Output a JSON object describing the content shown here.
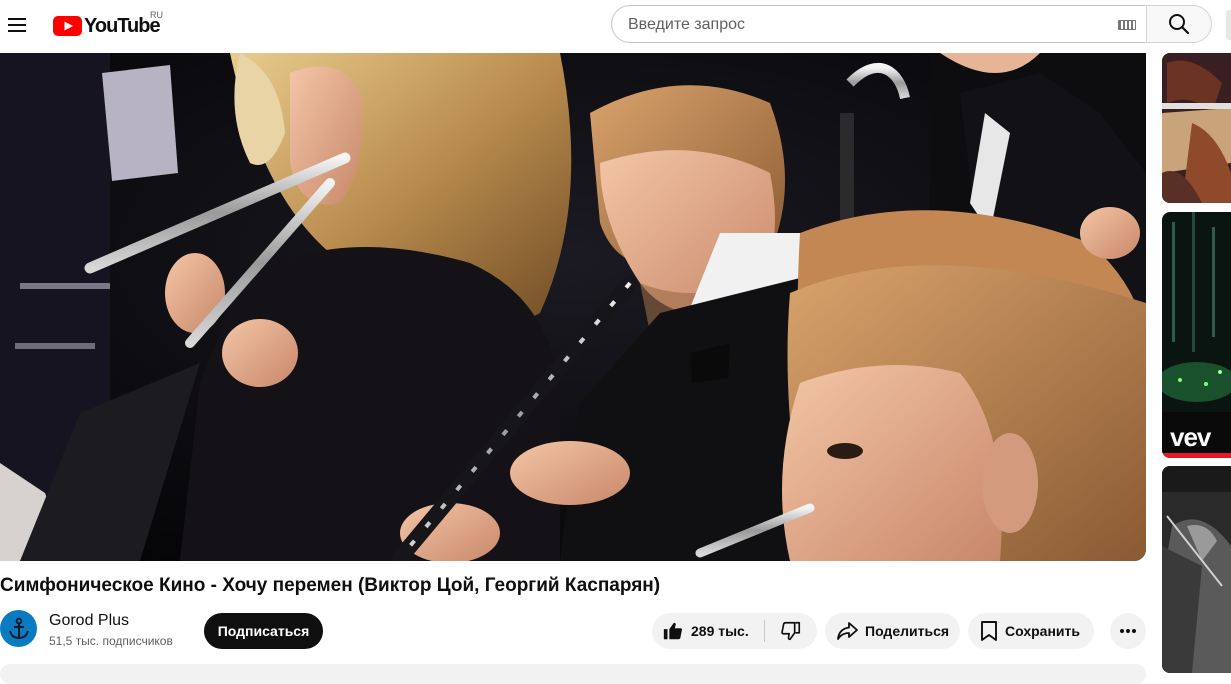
{
  "header": {
    "logo_text": "YouTube",
    "country_code": "RU",
    "search_placeholder": "Введите запрос"
  },
  "video": {
    "title": "Симфоническое Кино - Хочу перемен (Виктор Цой, Георгий Каспарян)"
  },
  "channel": {
    "name": "Gorod Plus",
    "subscribers": "51,5 тыс. подписчиков",
    "subscribe_label": "Подписаться"
  },
  "actions": {
    "like_count": "289 тыс.",
    "share_label": "Поделиться",
    "save_label": "Сохранить"
  },
  "sidebar": {
    "thumbnail_2_text": "vev"
  },
  "icons": {
    "menu": "hamburger-menu-icon",
    "logo": "youtube-play-icon",
    "keyboard": "keyboard-icon",
    "search": "search-icon",
    "like": "thumbs-up-icon",
    "dislike": "thumbs-down-icon",
    "share": "share-arrow-icon",
    "save": "bookmark-icon",
    "more": "more-dots-icon",
    "avatar": "anchor-icon"
  },
  "colors": {
    "brand_red": "#ff0000",
    "subscribe_bg": "#0f0f0f",
    "pill_bg": "#f2f2f2",
    "avatar_bg": "#0a7bc1"
  }
}
